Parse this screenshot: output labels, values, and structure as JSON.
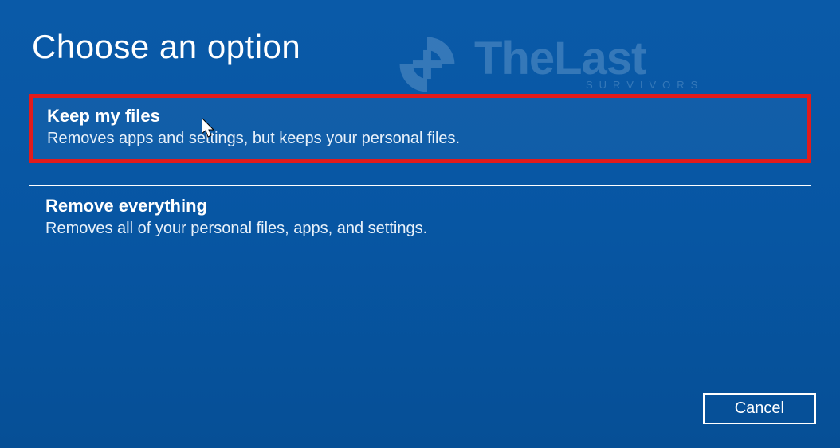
{
  "header": {
    "title": "Choose an option"
  },
  "options": [
    {
      "title": "Keep my files",
      "desc": "Removes apps and settings, but keeps your personal files.",
      "highlighted": true
    },
    {
      "title": "Remove everything",
      "desc": "Removes all of your personal files, apps, and settings.",
      "highlighted": false
    }
  ],
  "footer": {
    "cancel_label": "Cancel"
  },
  "watermark": {
    "main": "TheLast",
    "sub": "SURVIVORS"
  }
}
